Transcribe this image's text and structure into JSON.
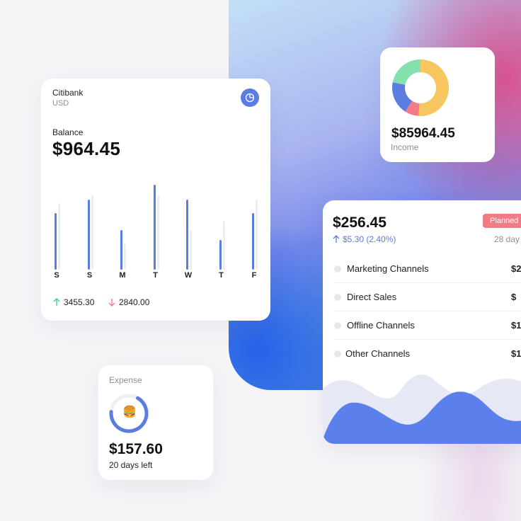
{
  "bank_card": {
    "bank_name": "Citibank",
    "currency": "USD",
    "icon": "pie-chart-icon",
    "balance_label": "Balance",
    "balance_value": "$964.45",
    "days": [
      "S",
      "S",
      "M",
      "T",
      "W",
      "T",
      "F"
    ],
    "bar_levels_primary": [
      0.57,
      0.71,
      0.4,
      0.86,
      0.71,
      0.3,
      0.57
    ],
    "bar_levels_secondary": [
      0.67,
      0.76,
      0.26,
      0.75,
      0.4,
      0.49,
      0.71
    ],
    "income_stat": "3455.30",
    "expense_stat": "2840.00",
    "accent_color": "#5a7de2"
  },
  "expense_card": {
    "label": "Expense",
    "icon": "burger-emoji",
    "value": "$157.60",
    "subtitle": "20 days left",
    "progress": 0.68
  },
  "income_card": {
    "value": "$85964.45",
    "label": "Income",
    "donut_segments": [
      {
        "color": "#f7c65f",
        "share": 0.51
      },
      {
        "color": "#f27c86",
        "share": 0.08
      },
      {
        "color": "#5b7de2",
        "share": 0.19
      },
      {
        "color": "#84e0ad",
        "share": 0.22
      }
    ]
  },
  "channels_card": {
    "value": "$256.45",
    "change": "$5.30 (2.40%)",
    "badge": "Planned",
    "days": "28 day",
    "rows": [
      {
        "name": "Marketing Channels",
        "amount": "$2"
      },
      {
        "name": "Direct Sales",
        "amount": "$"
      },
      {
        "name": "Offline Channels",
        "amount": "$1"
      },
      {
        "name": "Other Channels",
        "amount": "$1"
      }
    ]
  }
}
